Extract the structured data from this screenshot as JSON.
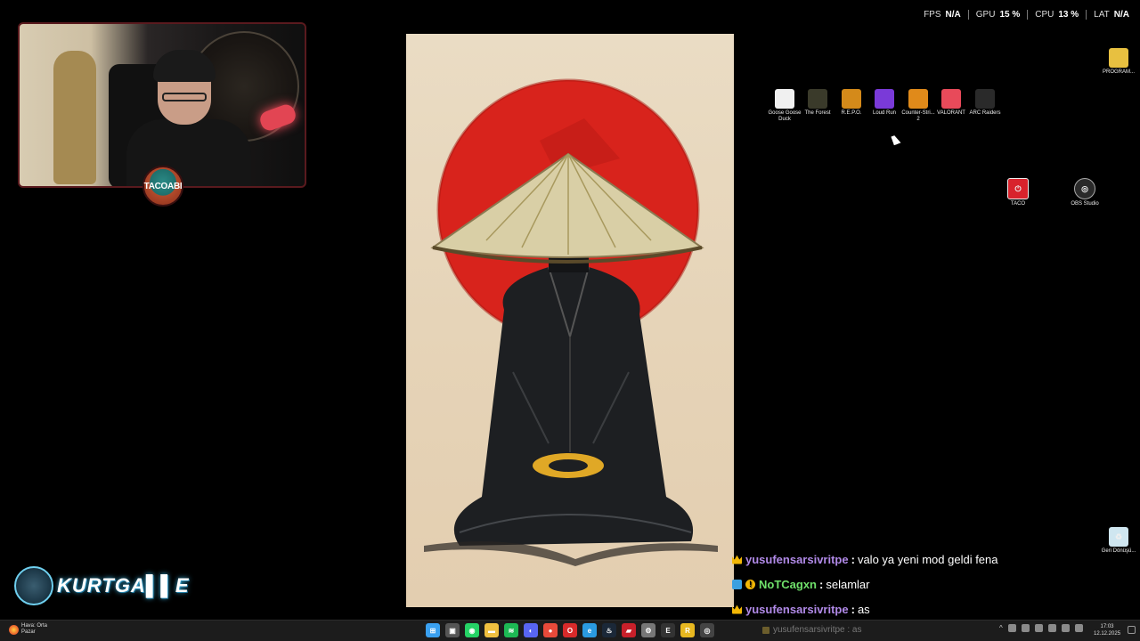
{
  "perf": {
    "fps_label": "FPS",
    "fps_value": "N/A",
    "gpu_label": "GPU",
    "gpu_value": "15 %",
    "cpu_label": "CPU",
    "cpu_value": "13 %",
    "lat_label": "LAT",
    "lat_value": "N/A"
  },
  "overlay": {
    "webcam_badge": "TACOABI",
    "logo_text": "KURTGA▌▌E"
  },
  "desktop": {
    "top_icons": [
      {
        "label": "Goose Goose Duck",
        "icon": "goose-icon",
        "color": "#f0f0f0"
      },
      {
        "label": "The Forest",
        "icon": "forest-icon",
        "color": "#3a3a2a"
      },
      {
        "label": "R.E.P.O.",
        "icon": "repo-icon",
        "color": "#d48a1a"
      },
      {
        "label": "Loud Run",
        "icon": "loud-run-icon",
        "color": "#7a3ad8"
      },
      {
        "label": "Counter-Stri... 2",
        "icon": "cs2-icon",
        "color": "#e08a1a"
      },
      {
        "label": "VALORANT",
        "icon": "valorant-icon",
        "color": "#e84a5a"
      },
      {
        "label": "ARC Raiders",
        "icon": "arc-raiders-icon",
        "color": "#2a2a2a"
      }
    ],
    "folder_label": "PROGRAM...",
    "taco_label": "TACO",
    "obs_label": "OBS Studio",
    "recycle_label": "Geri Dönüşü..."
  },
  "chat": {
    "messages": [
      {
        "user": "yusufensarsivritpe",
        "text": "valo ya yeni mod geldi fena",
        "color": "purple"
      },
      {
        "user": "NoTCagxn",
        "text": "selamlar",
        "color": "green"
      },
      {
        "user": "yusufensarsivritpe",
        "text": "as",
        "color": "purple"
      }
    ],
    "separator": ":"
  },
  "taskbar": {
    "weather_line1": "Hava: Orta",
    "weather_line2": "Pazar",
    "apps": [
      {
        "icon": "windows-start-icon",
        "color": "#3aa0f0",
        "glyph": "⊞"
      },
      {
        "icon": "task-view-icon",
        "color": "#555",
        "glyph": "▣"
      },
      {
        "icon": "whatsapp-icon",
        "color": "#25d366",
        "glyph": "◉"
      },
      {
        "icon": "file-explorer-icon",
        "color": "#f0c040",
        "glyph": "▬"
      },
      {
        "icon": "spotify-icon",
        "color": "#1db954",
        "glyph": "≋"
      },
      {
        "icon": "discord-icon",
        "color": "#5865f2",
        "glyph": "◐"
      },
      {
        "icon": "chrome-icon",
        "color": "#e84a3a",
        "glyph": "●"
      },
      {
        "icon": "opera-icon",
        "color": "#d82a2a",
        "glyph": "O"
      },
      {
        "icon": "edge-icon",
        "color": "#2a9ae0",
        "glyph": "e"
      },
      {
        "icon": "steam-icon",
        "color": "#1b2838",
        "glyph": "♨"
      },
      {
        "icon": "app-red-icon",
        "color": "#c8202a",
        "glyph": "▰"
      },
      {
        "icon": "settings-gear-icon",
        "color": "#777",
        "glyph": "⚙"
      },
      {
        "icon": "epic-games-icon",
        "color": "#333",
        "glyph": "E"
      },
      {
        "icon": "app-yellow-icon",
        "color": "#e8b820",
        "glyph": "R"
      },
      {
        "icon": "obs-taskbar-icon",
        "color": "#444",
        "glyph": "◎"
      }
    ],
    "chat_preview_user": "yusufensarsivritpe",
    "chat_preview_text": ": as",
    "clock_time": "17:03",
    "clock_date": "12.12.2025"
  }
}
